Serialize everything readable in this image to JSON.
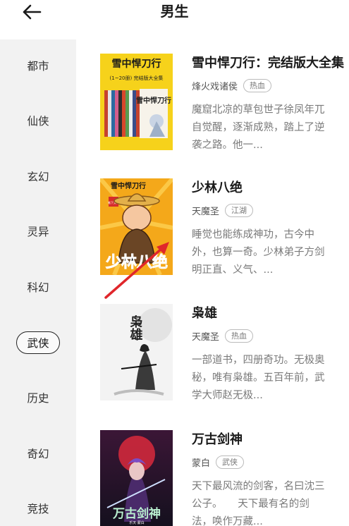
{
  "header": {
    "title": "男生"
  },
  "sidebar": {
    "items": [
      {
        "label": "都市",
        "active": false
      },
      {
        "label": "仙侠",
        "active": false
      },
      {
        "label": "玄幻",
        "active": false
      },
      {
        "label": "灵异",
        "active": false
      },
      {
        "label": "科幻",
        "active": false
      },
      {
        "label": "武侠",
        "active": true
      },
      {
        "label": "历史",
        "active": false
      },
      {
        "label": "奇幻",
        "active": false
      },
      {
        "label": "竞技",
        "active": false
      }
    ]
  },
  "books": [
    {
      "title": "雪中悍刀行：完结版大全集",
      "author": "烽火戏诸侯",
      "tag": "热血",
      "desc": "魔窟北凉的草包世子徐凤年兀自觉醒，逐渐成熟，踏上了逆袭之路。他一...",
      "cover_text_main": "雪中悍刀行",
      "cover_text_sub": "(1~20册) 完结版大全集",
      "cover_spine_text": "雪中悍刀行"
    },
    {
      "title": "少林八绝",
      "author": "天魔圣",
      "tag": "江湖",
      "desc": "睡觉也能练成神功，古今中外，也算一奇。少林弟子方剑明正直、义气、...",
      "cover_text_main": "少林八绝",
      "cover_text_top": "雪中悍刀行",
      "cover_badge": "笔下文学"
    },
    {
      "title": "枭雄",
      "author": "天魔圣",
      "tag": "热血",
      "desc": "一部道书，四册奇功。无极奥秘，唯有枭雄。五百年前，武学大师赵无极...",
      "cover_text_main": "枭雄"
    },
    {
      "title": "万古剑神",
      "author": "蒙白",
      "tag": "武侠",
      "desc": "天下最风流的剑客，名曰沈三公子。　　天下最有名的剑法，唤作万藏...",
      "cover_text_main": "万古剑神",
      "cover_text_sub": "乐天·蒙白"
    }
  ],
  "colors": {
    "sidebar_bg": "#f2f2f2",
    "annotation_arrow": "#e0262b",
    "cover1_bg": "#f6d21b",
    "cover2_bg": "#f4a81a",
    "cover4_bg": "#2a1230"
  }
}
